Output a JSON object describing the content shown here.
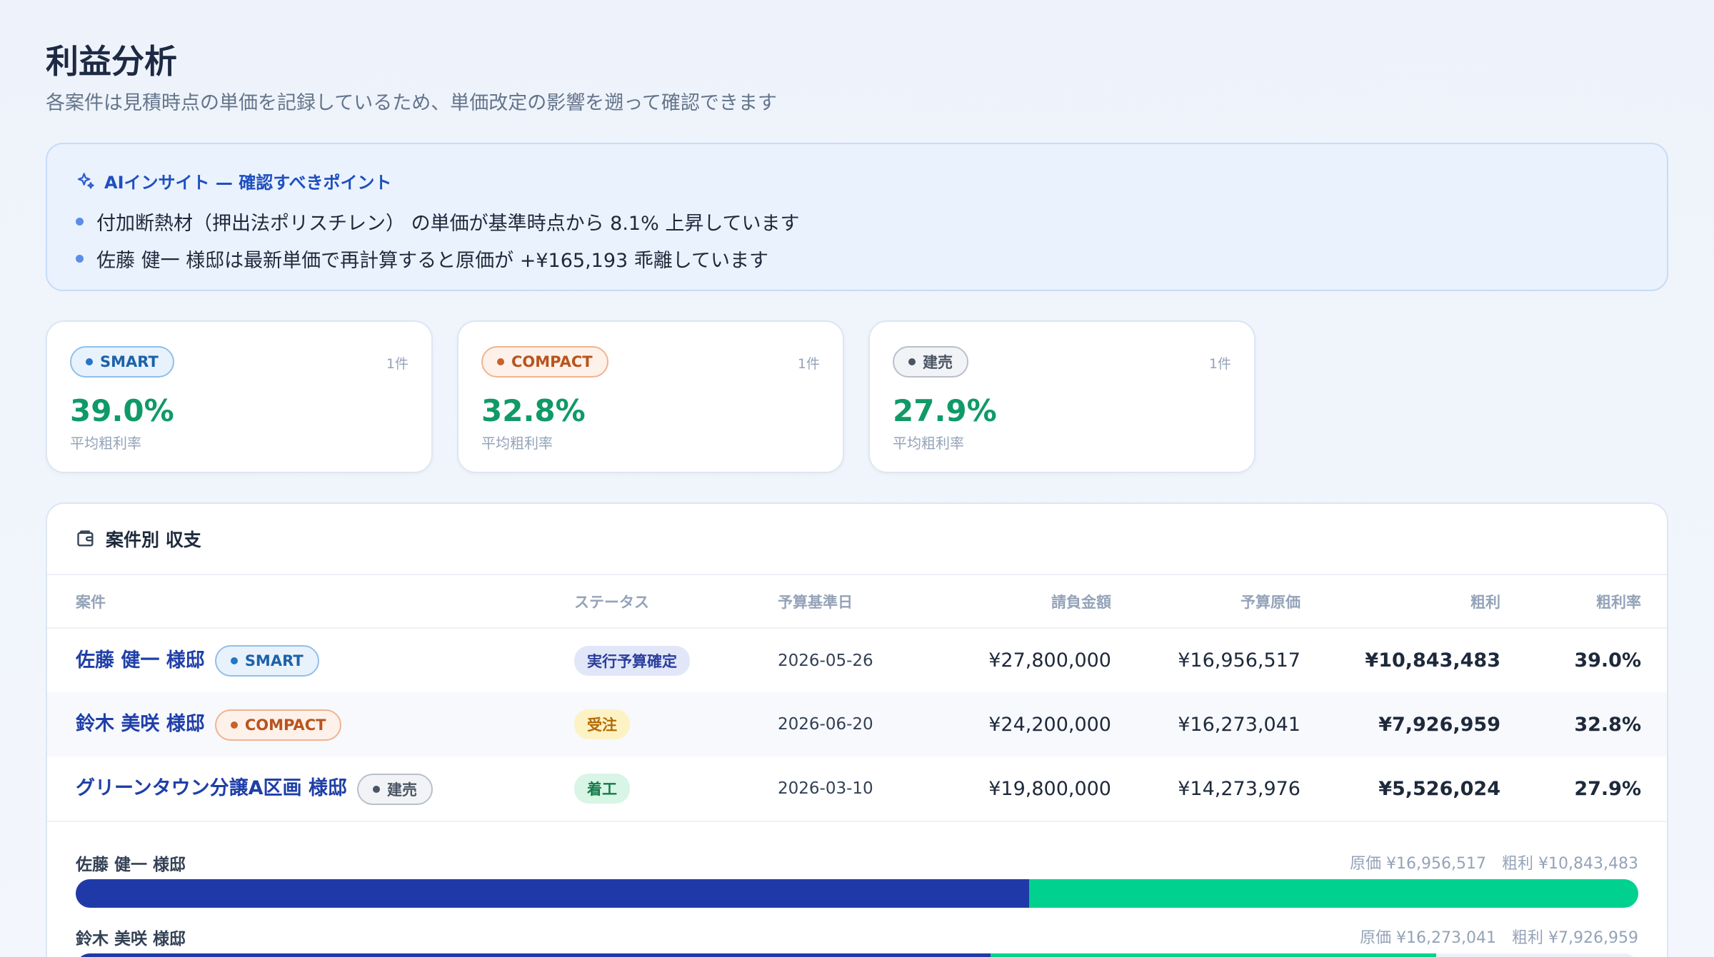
{
  "header": {
    "title": "利益分析",
    "subtitle": "各案件は見積時点の単価を記録しているため、単価改定の影響を遡って確認できます"
  },
  "insight": {
    "heading": "AIインサイト — 確認すべきポイント",
    "items": [
      "付加断熱材（押出法ポリスチレン） の単価が基準時点から 8.1% 上昇しています",
      "佐藤 健一 様邸は最新単価で再計算すると原価が +¥165,193 乖離しています"
    ]
  },
  "cards": [
    {
      "tag": "SMART",
      "count": "1件",
      "rate": "39.0%",
      "rate_label": "平均粗利率"
    },
    {
      "tag": "COMPACT",
      "count": "1件",
      "rate": "32.8%",
      "rate_label": "平均粗利率"
    },
    {
      "tag": "建売",
      "count": "1件",
      "rate": "27.9%",
      "rate_label": "平均粗利率"
    }
  ],
  "panel": {
    "title": "案件別 収支",
    "columns": {
      "name": "案件",
      "status": "ステータス",
      "date": "予算基準日",
      "contract": "請負金額",
      "cost": "予算原価",
      "profit": "粗利",
      "rate": "粗利率"
    },
    "rows": [
      {
        "name": "佐藤 健一 様邸",
        "tag": "SMART",
        "status": "実行予算確定",
        "date": "2026-05-26",
        "contract": "¥27,800,000",
        "cost": "¥16,956,517",
        "profit": "¥10,843,483",
        "rate": "39.0%"
      },
      {
        "name": "鈴木 美咲 様邸",
        "tag": "COMPACT",
        "status": "受注",
        "date": "2026-06-20",
        "contract": "¥24,200,000",
        "cost": "¥16,273,041",
        "profit": "¥7,926,959",
        "rate": "32.8%"
      },
      {
        "name": "グリーンタウン分譲A区画 様邸",
        "tag": "建売",
        "status": "着工",
        "date": "2026-03-10",
        "contract": "¥19,800,000",
        "cost": "¥14,273,976",
        "profit": "¥5,526,024",
        "rate": "27.9%"
      }
    ],
    "bars": [
      {
        "name": "佐藤 健一 様邸",
        "cost_text": "原価 ¥16,956,517",
        "profit_text": "粗利 ¥10,843,483",
        "cost": 16956517,
        "profit": 10843483
      },
      {
        "name": "鈴木 美咲 様邸",
        "cost_text": "原価 ¥16,273,041",
        "profit_text": "粗利 ¥7,926,959",
        "cost": 16273041,
        "profit": 7926959
      }
    ],
    "bar_scale_max": 27800000
  },
  "colors": {
    "accent": "#1f3fa8",
    "profit_green": "#0f9a67",
    "bar_cost": "#1f3aa8",
    "bar_profit": "#00d18f"
  }
}
